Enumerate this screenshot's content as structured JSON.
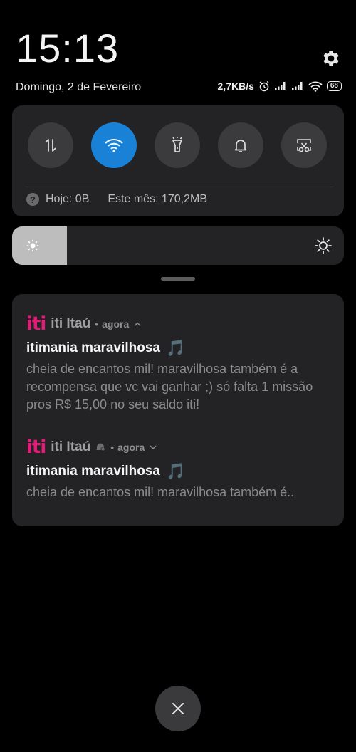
{
  "clock": {
    "time": "15:13",
    "date": "Domingo, 2 de Fevereiro"
  },
  "status_bar": {
    "speed": "2,7KB/s",
    "battery": "68",
    "icons": [
      "alarm-icon",
      "signal-icon",
      "signal-icon",
      "wifi-icon",
      "battery-icon"
    ]
  },
  "quick_settings": {
    "toggles": [
      {
        "name": "mobile-data",
        "icon": "data-arrows-icon",
        "active": false
      },
      {
        "name": "wifi",
        "icon": "wifi-icon",
        "active": true
      },
      {
        "name": "flashlight",
        "icon": "flashlight-icon",
        "active": false
      },
      {
        "name": "sound",
        "icon": "bell-icon",
        "active": false
      },
      {
        "name": "screenshot",
        "icon": "scissors-icon",
        "active": false
      }
    ],
    "data_today": "Hoje: 0B",
    "data_month": "Este mês: 170,2MB"
  },
  "brightness": {
    "level": 0.165
  },
  "notifications": [
    {
      "app": "iti Itaú",
      "logo_text": "iti",
      "time": "agora",
      "title": "itimania maravilhosa",
      "title_emoji": "🎵",
      "body": "cheia de encantos mil! maravilhosa também é a recompensa que vc vai ganhar ;) só falta 1 missão pros R$ 15,00 no seu saldo iti!",
      "expanded": true
    },
    {
      "app": "iti Itaú",
      "logo_text": "iti",
      "time": "agora",
      "title": "itimania maravilhosa",
      "title_emoji": "🎵",
      "body": "cheia de encantos mil! maravilhosa também é..",
      "expanded": false
    }
  ],
  "colors": {
    "accent": "#1a82d6",
    "brand": "#e11c77",
    "panel": "#232325"
  }
}
